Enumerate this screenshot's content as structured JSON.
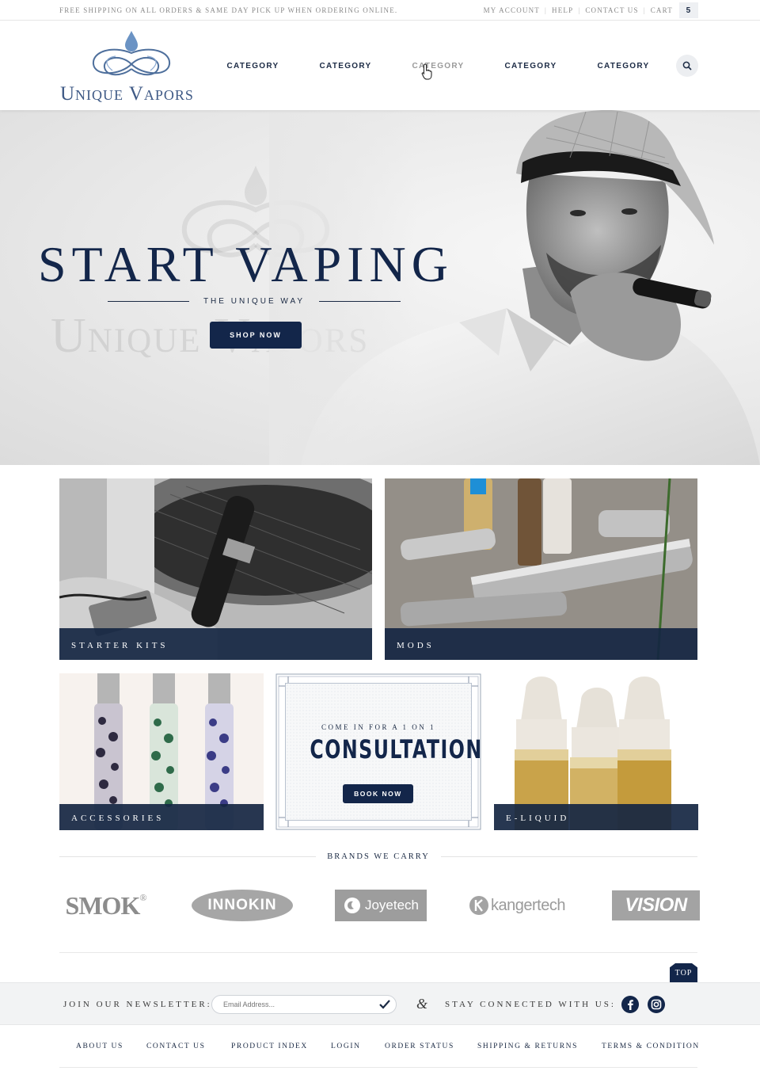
{
  "topbar": {
    "promo": "Free shipping on all orders & same day pick  up when ordering online.",
    "links": [
      "My Account",
      "Help",
      "Contact Us",
      "Cart"
    ],
    "cart_count": "5"
  },
  "header": {
    "logo_text": "Unique Vapors",
    "nav": [
      "CATEGORY",
      "CATEGORY",
      "CATEGORY",
      "CATEGORY",
      "CATEGORY"
    ]
  },
  "hero": {
    "title": "START VAPING",
    "subtitle": "THE UNIQUE WAY",
    "watermark": "Unique Vapors",
    "cta": "SHOP NOW"
  },
  "tiles": {
    "starter": "Starter Kits",
    "mods": "Mods",
    "accessories": "Accessories",
    "eliquid": "E-Liquid"
  },
  "consult": {
    "pre": "Come in for a 1 on 1",
    "title": "CONSULTATION",
    "cta": "BOOK NOW"
  },
  "brands": {
    "heading": "Brands We Carry",
    "names": [
      "SMOK",
      "INNOKIN",
      "Joyetech",
      "kangertech",
      "VISION"
    ]
  },
  "top_button": "TOP",
  "newsletter": {
    "label": "Join our Newsletter:",
    "placeholder": "Email Address...",
    "social_label": "Stay connected with us:"
  },
  "footer": {
    "links": [
      "About Us",
      "Contact Us",
      "Product Index",
      "Login",
      "Order Status",
      "Shipping & Returns",
      "Terms & Condition"
    ]
  }
}
